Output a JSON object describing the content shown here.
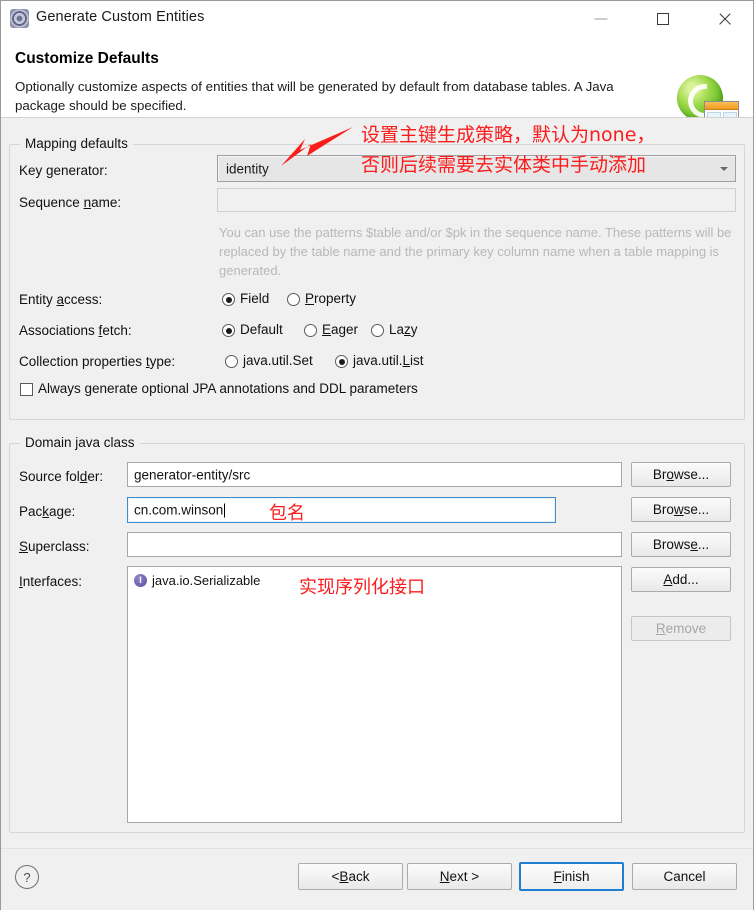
{
  "window": {
    "title": "Generate Custom Entities",
    "icon": "gear-icon",
    "minimize": "—",
    "maximize": "☐",
    "close": "✕"
  },
  "header": {
    "title": "Customize Defaults",
    "description": "Optionally customize aspects of entities that will be generated by default from database tables. A Java package should be specified.",
    "logo": "database-table-logo"
  },
  "mapping_defaults": {
    "legend": "Mapping defaults",
    "key_generator": {
      "label": "Key generator:",
      "mnemonic": "g",
      "value": "identity"
    },
    "sequence_name": {
      "label": "Sequence name:",
      "mnemonic": "n",
      "value": ""
    },
    "hint": "You can use the patterns $table and/or $pk in the sequence name. These patterns will be replaced by the table name and the primary key column name when a table mapping is generated.",
    "entity_access": {
      "label": "Entity access:",
      "mnemonic": "a",
      "options": [
        "Field",
        "Property"
      ],
      "mnemonics": [
        "",
        "P"
      ],
      "selected": "Field"
    },
    "associations_fetch": {
      "label": "Associations fetch:",
      "mnemonic": "f",
      "options": [
        "Default",
        "Eager",
        "Lazy"
      ],
      "mnemonics": [
        "",
        "E",
        "z"
      ],
      "selected": "Default"
    },
    "collection_properties_type": {
      "label": "Collection properties type:",
      "mnemonic": "t",
      "options": [
        "java.util.Set",
        "java.util.List"
      ],
      "selected": "java.util.List"
    },
    "always_generate": {
      "label": "Always generate optional JPA annotations and DDL parameters",
      "checked": false
    }
  },
  "domain_java_class": {
    "legend": "Domain java class",
    "source_folder": {
      "label": "Source folder:",
      "mnemonic": "d",
      "value": "generator-entity/src",
      "button": "Browse...",
      "button_mnemonic": "o"
    },
    "package": {
      "label": "Package:",
      "mnemonic": "k",
      "value": "cn.com.winson",
      "focused": true,
      "button": "Browse...",
      "button_mnemonic": "w"
    },
    "superclass": {
      "label": "Superclass:",
      "mnemonic": "S",
      "value": "",
      "button": "Browse...",
      "button_mnemonic": "e"
    },
    "interfaces": {
      "label": "Interfaces:",
      "mnemonic": "I",
      "items": [
        {
          "name": "java.io.Serializable",
          "icon": "interface-icon"
        }
      ],
      "add_button": "Add...",
      "add_mnemonic": "A",
      "remove_button": "Remove",
      "remove_mnemonic": "R",
      "remove_enabled": false
    }
  },
  "footer": {
    "help": "?",
    "back": "< Back",
    "back_mnemonic": "B",
    "next": "Next >",
    "next_mnemonic": "N",
    "finish": "Finish",
    "finish_mnemonic": "F",
    "finish_default": true,
    "cancel": "Cancel"
  },
  "annotations": {
    "color": "#fc1c1c",
    "key_generator_note_line1": "设置主键生成策略，默认为none，",
    "key_generator_note_line2": "否则后续需要去实体类中手动添加",
    "package_note": "包名",
    "interfaces_note": "实现序列化接口"
  }
}
